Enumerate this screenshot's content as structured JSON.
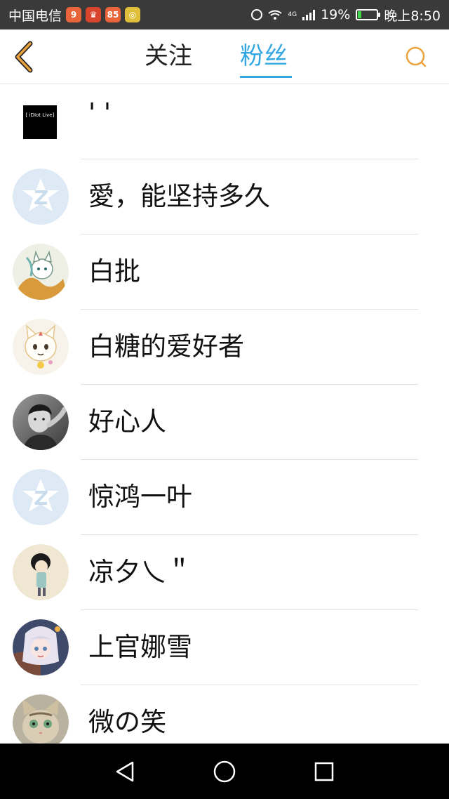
{
  "status_bar": {
    "carrier": "中国电信",
    "apps": [
      {
        "icon": "app-badge-icon-1",
        "text": "9",
        "color": "#e8643a"
      },
      {
        "icon": "app-badge-icon-2",
        "text": "♛",
        "color": "#d9442c"
      },
      {
        "icon": "app-badge-icon-3",
        "text": "85",
        "color": "#e8643a"
      },
      {
        "icon": "app-badge-icon-4",
        "text": "◎",
        "color": "#e0c03a"
      }
    ],
    "network": "4G",
    "battery": "19%",
    "battery_level": 0.19,
    "time": "晚上8:50"
  },
  "header": {
    "back_icon": "chevron-left-icon",
    "tabs": [
      {
        "label": "关注",
        "active": false
      },
      {
        "label": "粉丝",
        "active": true
      }
    ],
    "search_icon": "search-icon",
    "accent_color": "#33a7e2",
    "icon_color": "#e9a23b"
  },
  "followers": [
    {
      "name": "' '",
      "avatar": "idiot-live-logo",
      "avatar_text": "[ iDIot Live]"
    },
    {
      "name": "愛，能坚持多久",
      "avatar": "default-qzone-avatar"
    },
    {
      "name": "白批",
      "avatar": "cat-illustration-avatar"
    },
    {
      "name": "白糖的爱好者",
      "avatar": "cartoon-cat-avatar"
    },
    {
      "name": "好心人",
      "avatar": "boy-photo-avatar"
    },
    {
      "name": "惊鸿一叶",
      "avatar": "default-qzone-avatar"
    },
    {
      "name": "凉夕乀＂",
      "avatar": "cartoon-boy-avatar"
    },
    {
      "name": "上官娜雪",
      "avatar": "anime-girl-avatar"
    },
    {
      "name": "微の笑",
      "avatar": "kitten-photo-avatar"
    }
  ],
  "nav_bar": {
    "back": "nav-back-icon",
    "home": "nav-home-icon",
    "recents": "nav-recents-icon"
  }
}
